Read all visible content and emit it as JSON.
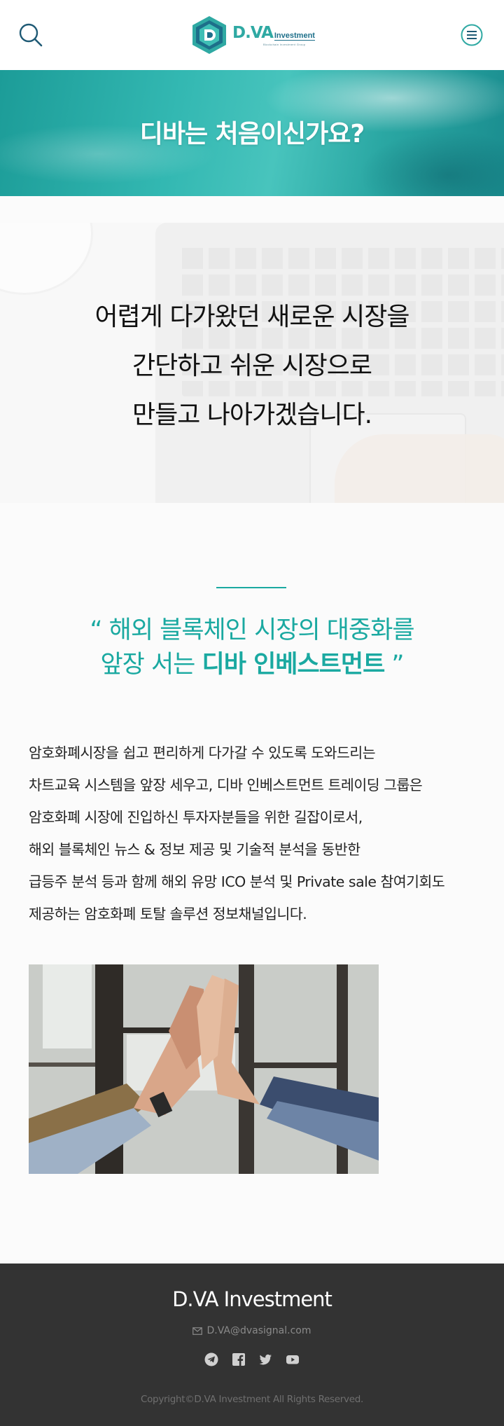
{
  "header": {
    "logo": {
      "brand": "D.VA",
      "suffix": "Investment",
      "tagline": "Blockchain Investment Group"
    },
    "icons": {
      "search": "search-icon",
      "menu": "menu-icon"
    },
    "colors": {
      "brand_teal": "#2fa9a3",
      "brand_navy": "#1d6f8a"
    }
  },
  "banner": {
    "title": "디바는 처음이신가요?"
  },
  "hero": {
    "lines": [
      "어렵게 다가왔던 새로운 시장을",
      "간단하고 쉬운 시장으로",
      "만들고 나아가겠습니다."
    ]
  },
  "intro": {
    "quote_line1": "“ 해외 블록체인 시장의 대중화를",
    "quote_line2_prefix": "앞장 서는 ",
    "quote_line2_bold": "디바 인베스트먼트",
    "quote_line2_suffix": " ”",
    "paragraph": [
      "암호화폐시장을 쉽고 편리하게 다가갈 수 있도록 도와드리는",
      "차트교육 시스템을 앞장 세우고, 디바 인베스트먼트 트레이딩 그룹은",
      "암호화폐 시장에 진입하신 투자자분들을 위한 길잡이로서,",
      "해외 블록체인 뉴스 & 정보 제공 및 기술적 분석을 동반한",
      "급등주 분석 등과 함께 해외 유망 ICO 분석 및 Private sale 참여기회도",
      "제공하는 암호화폐 토탈 솔루션 정보채널입니다."
    ],
    "accent_color": "#1aa9a1"
  },
  "footer": {
    "brand": "D.VA Investment",
    "email": "D.VA@dvasignal.com",
    "copyright": "Copyright©D.VA Investment All Rights Reserved.",
    "socials": [
      "telegram-icon",
      "facebook-icon",
      "twitter-icon",
      "youtube-icon"
    ],
    "background": "#333333"
  }
}
